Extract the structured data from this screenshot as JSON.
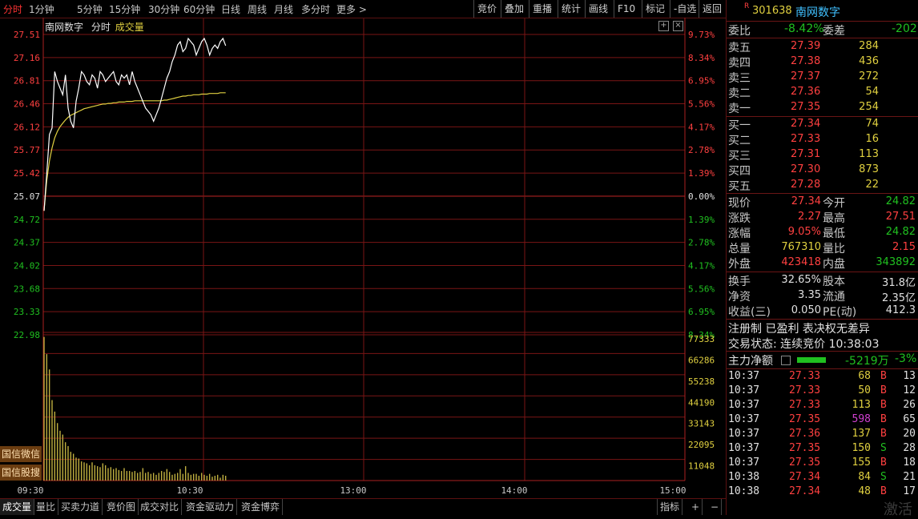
{
  "toolbar": {
    "periods": [
      "分时",
      "1分钟",
      "5分钟",
      "15分钟",
      "30分钟",
      "60分钟",
      "日线",
      "周线",
      "月线",
      "多分时",
      "更多 >"
    ],
    "buttons": [
      "竞价",
      "叠加",
      "重播",
      "统计",
      "画线",
      "F10",
      "标记",
      "-自选",
      "返回"
    ]
  },
  "chart": {
    "legend_stock": "南网数字",
    "legend_mode": "分时",
    "legend_volume": "成交量",
    "price_ticks": [
      "27.51",
      "27.16",
      "26.81",
      "26.46",
      "26.12",
      "25.77",
      "25.42",
      "25.07",
      "24.72",
      "24.37",
      "24.02",
      "23.68",
      "23.33",
      "22.98"
    ],
    "pct_ticks": [
      "9.73%",
      "8.34%",
      "6.95%",
      "5.56%",
      "4.17%",
      "2.78%",
      "1.39%",
      "0.00%",
      "1.39%",
      "2.78%",
      "4.17%",
      "5.56%",
      "6.95%",
      "8.34%"
    ],
    "vol_ticks": [
      "77333",
      "66286",
      "55238",
      "44190",
      "33143",
      "22095",
      "11048"
    ],
    "time_ticks": [
      "09:30",
      "10:30",
      "13:00",
      "14:00",
      "15:00"
    ],
    "side_buttons": [
      "国信微信",
      "国信股搜"
    ]
  },
  "chart_data": {
    "type": "line",
    "title": "南网数字",
    "x": [
      "09:30",
      "09:31",
      "09:32",
      "09:33",
      "09:34",
      "09:35",
      "09:36",
      "09:37",
      "09:38",
      "09:39",
      "09:40",
      "09:41",
      "09:42",
      "09:43",
      "09:44",
      "09:45",
      "09:46",
      "09:47",
      "09:48",
      "09:49",
      "09:50",
      "09:51",
      "09:52",
      "09:53",
      "09:54",
      "09:55",
      "09:56",
      "09:57",
      "09:58",
      "09:59",
      "10:00",
      "10:01",
      "10:02",
      "10:03",
      "10:04",
      "10:05",
      "10:06",
      "10:07",
      "10:08",
      "10:09",
      "10:10",
      "10:11",
      "10:12",
      "10:13",
      "10:14",
      "10:15",
      "10:16",
      "10:17",
      "10:18",
      "10:19",
      "10:20",
      "10:21",
      "10:22",
      "10:23",
      "10:24",
      "10:25",
      "10:26",
      "10:27",
      "10:28",
      "10:29",
      "10:30",
      "10:31",
      "10:32",
      "10:33",
      "10:34",
      "10:35",
      "10:36",
      "10:37",
      "10:38"
    ],
    "series": [
      {
        "name": "price",
        "values": [
          24.85,
          25.4,
          26.0,
          26.1,
          26.95,
          26.8,
          26.7,
          26.6,
          26.9,
          26.4,
          26.2,
          26.1,
          26.5,
          26.7,
          26.95,
          26.9,
          26.8,
          26.75,
          26.9,
          26.85,
          26.7,
          26.95,
          26.9,
          26.8,
          26.85,
          26.9,
          26.95,
          26.8,
          26.75,
          26.9,
          26.85,
          26.9,
          26.75,
          26.95,
          26.8,
          26.7,
          26.6,
          26.5,
          26.4,
          26.35,
          26.3,
          26.2,
          26.3,
          26.4,
          26.55,
          26.7,
          26.85,
          26.95,
          27.1,
          27.2,
          27.35,
          27.4,
          27.25,
          27.3,
          27.45,
          27.4,
          27.35,
          27.2,
          27.3,
          27.4,
          27.45,
          27.35,
          27.2,
          27.3,
          27.35,
          27.3,
          27.4,
          27.45,
          27.34
        ]
      },
      {
        "name": "avg",
        "values": [
          24.85,
          25.3,
          25.6,
          25.8,
          25.95,
          26.05,
          26.12,
          26.17,
          26.22,
          26.26,
          26.29,
          26.31,
          26.33,
          26.35,
          26.37,
          26.39,
          26.4,
          26.41,
          26.42,
          26.43,
          26.44,
          26.45,
          26.46,
          26.46,
          26.47,
          26.47,
          26.48,
          26.48,
          26.49,
          26.49,
          26.49,
          26.5,
          26.5,
          26.5,
          26.51,
          26.51,
          26.51,
          26.51,
          26.51,
          26.51,
          26.51,
          26.51,
          26.51,
          26.51,
          26.51,
          26.52,
          26.52,
          26.53,
          26.54,
          26.55,
          26.56,
          26.57,
          26.58,
          26.58,
          26.59,
          26.59,
          26.6,
          26.6,
          26.6,
          26.61,
          26.61,
          26.61,
          26.62,
          26.62,
          26.62,
          26.62,
          26.63,
          26.63,
          26.63
        ]
      },
      {
        "name": "volume",
        "values": [
          75000,
          66000,
          58000,
          42000,
          36000,
          30000,
          26000,
          24000,
          20000,
          18000,
          15000,
          14000,
          12000,
          11500,
          10000,
          9500,
          9000,
          8000,
          9500,
          8000,
          7500,
          7000,
          9000,
          8000,
          6500,
          7000,
          6000,
          6500,
          5500,
          5000,
          6500,
          5000,
          5000,
          4500,
          5000,
          4000,
          4500,
          6500,
          4000,
          4500,
          3500,
          4000,
          3000,
          4000,
          5000,
          4500,
          6000,
          4500,
          3000,
          3500,
          4000,
          6000,
          3500,
          7500,
          4000,
          3000,
          3500,
          3500,
          2500,
          4000,
          3000,
          2500,
          3500,
          2000,
          2500,
          3000,
          1500,
          3000,
          2500
        ]
      }
    ],
    "ylim": [
      22.98,
      27.51
    ],
    "y_ref": 25.07,
    "vol_ylim": [
      0,
      77333
    ],
    "grid": true
  },
  "quote": {
    "code": "301638",
    "name": "南网数字",
    "weibi_label": "委比",
    "weibi": "-8.42%",
    "weicha_label": "委差",
    "weicha": "-202",
    "asks": [
      {
        "label": "卖五",
        "price": "27.39",
        "vol": "284"
      },
      {
        "label": "卖四",
        "price": "27.38",
        "vol": "436"
      },
      {
        "label": "卖三",
        "price": "27.37",
        "vol": "272"
      },
      {
        "label": "卖二",
        "price": "27.36",
        "vol": "54"
      },
      {
        "label": "卖一",
        "price": "27.35",
        "vol": "254"
      }
    ],
    "bids": [
      {
        "label": "买一",
        "price": "27.34",
        "vol": "74"
      },
      {
        "label": "买二",
        "price": "27.33",
        "vol": "16"
      },
      {
        "label": "买三",
        "price": "27.31",
        "vol": "113"
      },
      {
        "label": "买四",
        "price": "27.30",
        "vol": "873"
      },
      {
        "label": "买五",
        "price": "27.28",
        "vol": "22"
      }
    ],
    "stats1": [
      {
        "l1": "现价",
        "v1": "27.34",
        "l2": "今开",
        "v2": "24.82",
        "c1": "red",
        "c2": "green"
      },
      {
        "l1": "涨跌",
        "v1": "2.27",
        "l2": "最高",
        "v2": "27.51",
        "c1": "red",
        "c2": "red"
      },
      {
        "l1": "涨幅",
        "v1": "9.05%",
        "l2": "最低",
        "v2": "24.82",
        "c1": "red",
        "c2": "green"
      },
      {
        "l1": "总量",
        "v1": "767310",
        "l2": "量比",
        "v2": "2.15",
        "c1": "yellow",
        "c2": "red"
      },
      {
        "l1": "外盘",
        "v1": "423418",
        "l2": "内盘",
        "v2": "343892",
        "c1": "red",
        "c2": "green"
      }
    ],
    "stats2": [
      {
        "l1": "换手",
        "v1": "32.65%",
        "l2": "股本",
        "v2": "31.8亿"
      },
      {
        "l1": "净资",
        "v1": "3.35",
        "l2": "流通",
        "v2": "2.35亿"
      },
      {
        "l1": "收益(三)",
        "v1": "0.050",
        "l2": "PE(动)",
        "v2": "412.3"
      }
    ],
    "registration": "注册制 已盈利 表决权无差异",
    "trade_status": "交易状态: 连续竞价 10:38:03",
    "main_flow_label": "主力净额",
    "main_flow_value": "-5219万",
    "main_flow_pct": "-3%",
    "ticks": [
      {
        "t": "10:37",
        "p": "27.33",
        "v": "68",
        "s": "B",
        "n": "13",
        "vc": "yellow",
        "sc": "red"
      },
      {
        "t": "10:37",
        "p": "27.33",
        "v": "50",
        "s": "B",
        "n": "12",
        "vc": "yellow",
        "sc": "red"
      },
      {
        "t": "10:37",
        "p": "27.33",
        "v": "113",
        "s": "B",
        "n": "26",
        "vc": "yellow",
        "sc": "red"
      },
      {
        "t": "10:37",
        "p": "27.35",
        "v": "598",
        "s": "B",
        "n": "65",
        "vc": "purple",
        "sc": "red"
      },
      {
        "t": "10:37",
        "p": "27.36",
        "v": "137",
        "s": "B",
        "n": "20",
        "vc": "yellow",
        "sc": "red"
      },
      {
        "t": "10:37",
        "p": "27.35",
        "v": "150",
        "s": "S",
        "n": "28",
        "vc": "yellow",
        "sc": "green"
      },
      {
        "t": "10:37",
        "p": "27.35",
        "v": "155",
        "s": "B",
        "n": "18",
        "vc": "yellow",
        "sc": "red"
      },
      {
        "t": "10:38",
        "p": "27.34",
        "v": "84",
        "s": "S",
        "n": "21",
        "vc": "yellow",
        "sc": "green"
      },
      {
        "t": "10:38",
        "p": "27.34",
        "v": "48",
        "s": "B",
        "n": "17",
        "vc": "yellow",
        "sc": "red"
      }
    ],
    "watermark": "激活"
  },
  "bottom_tabs": [
    "成交量",
    "量比",
    "买卖力道",
    "竞价图",
    "成交对比",
    "资金驱动力",
    "资金博弈"
  ],
  "bottom_right": [
    "指标",
    "+",
    "−"
  ],
  "colors": {
    "up": "#ff4040",
    "down": "#20c020",
    "grid": "#7a1515",
    "price_line": "#ffffff",
    "avg_line": "#e0d040",
    "volume": "#c0b040"
  }
}
